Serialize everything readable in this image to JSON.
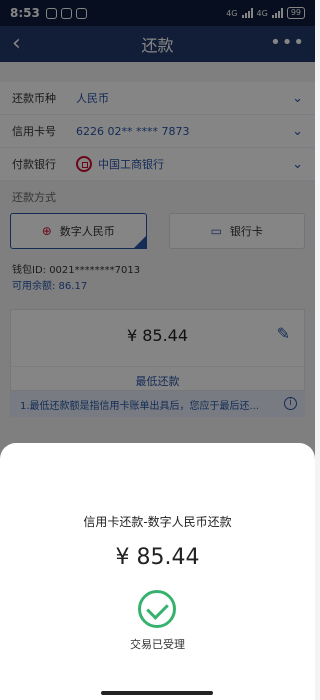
{
  "status_bar": {
    "time": "8:53",
    "network_a": "4G",
    "network_b": "4G",
    "battery": "99"
  },
  "nav": {
    "back_icon": "chevron-left-icon",
    "title": "还款",
    "more_icon": "more-dots-icon"
  },
  "form": {
    "currency_label": "还款币种",
    "currency_value": "人民币",
    "card_label": "信用卡号",
    "card_value": "6226 02** **** 7873",
    "bank_label": "付款银行",
    "bank_value": "中国工商银行"
  },
  "method": {
    "section_title": "还款方式",
    "option_digital": "数字人民币",
    "option_card": "银行卡",
    "selected": "数字人民币"
  },
  "wallet": {
    "id": "钱包ID: 0021********7013",
    "balance": "可用余额: 86.17"
  },
  "amount": {
    "value": "¥ 85.44",
    "min_payment_label": "最低还款"
  },
  "notice": {
    "text": "1.最低还款额是指信用卡账单出具后，您应于最后还..."
  },
  "result_sheet": {
    "title": "信用卡还款-数字人民币还款",
    "amount": "¥ 85.44",
    "status": "交易已受理",
    "status_icon": "success-check-icon",
    "accent_color": "#37b26e"
  }
}
